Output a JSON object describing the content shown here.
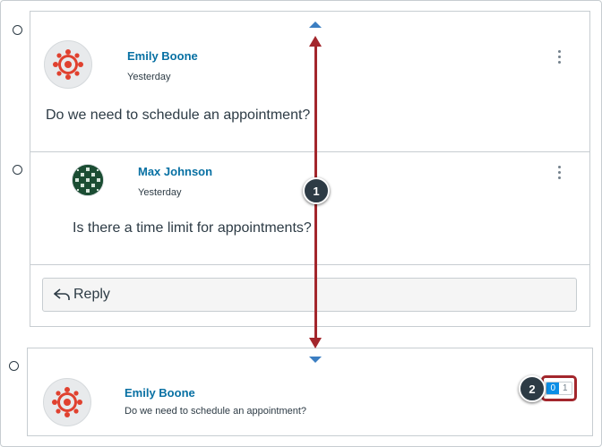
{
  "thread": {
    "entry": {
      "author": "Emily Boone",
      "date": "Yesterday",
      "message": "Do we need to schedule an appointment?"
    },
    "reply": {
      "author": "Max Johnson",
      "date": "Yesterday",
      "message": "Is there a time limit for appointments?"
    },
    "reply_button_label": "Reply"
  },
  "collapsed_entry": {
    "author": "Emily Boone",
    "message": "Do we need to schedule an appointment?",
    "unread_count": "0",
    "total_count": "1"
  },
  "callouts": {
    "first": "1",
    "second": "2"
  },
  "colors": {
    "link": "#0770a3",
    "annotation": "#a3262c",
    "unread_badge": "#0b8ee6",
    "canvas_red": "#e0412f"
  },
  "icons": [
    "canvas-avatar-icon",
    "profile-pattern-icon",
    "kebab-menu-icon",
    "reply-arrow-icon",
    "collapse-up-icon",
    "expand-down-icon"
  ]
}
